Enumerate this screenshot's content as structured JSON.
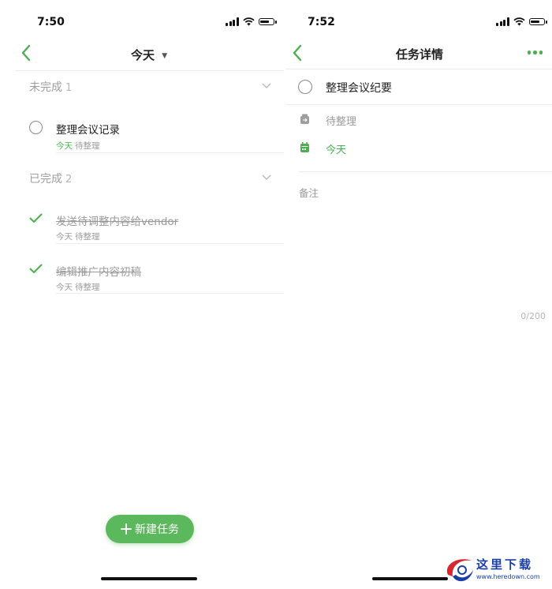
{
  "colors": {
    "accent": "#4caf50",
    "fab": "#5cb85c",
    "muted": "#9a9a9a"
  },
  "left": {
    "status_time": "7:50",
    "nav": {
      "title": "今天"
    },
    "sections": [
      {
        "label": "未完成",
        "count": "1"
      },
      {
        "label": "已完成",
        "count": "2"
      }
    ],
    "tasks_pending": [
      {
        "title": "整理会议记录",
        "date": "今天",
        "list": "待整理"
      }
    ],
    "tasks_done": [
      {
        "title": "发送待调整内容给vendor",
        "date": "今天",
        "list": "待整理"
      },
      {
        "title": "编辑推广内容初稿",
        "date": "今天",
        "list": "待整理"
      }
    ],
    "fab_label": "新建任务"
  },
  "right": {
    "status_time": "7:52",
    "nav": {
      "title": "任务详情"
    },
    "task": {
      "title": "整理会议纪要",
      "list": "待整理",
      "date": "今天"
    },
    "notes_label": "备注",
    "char_counter": "0/200"
  },
  "watermark": {
    "text": "这里下载",
    "url": "www.heredown.com"
  }
}
